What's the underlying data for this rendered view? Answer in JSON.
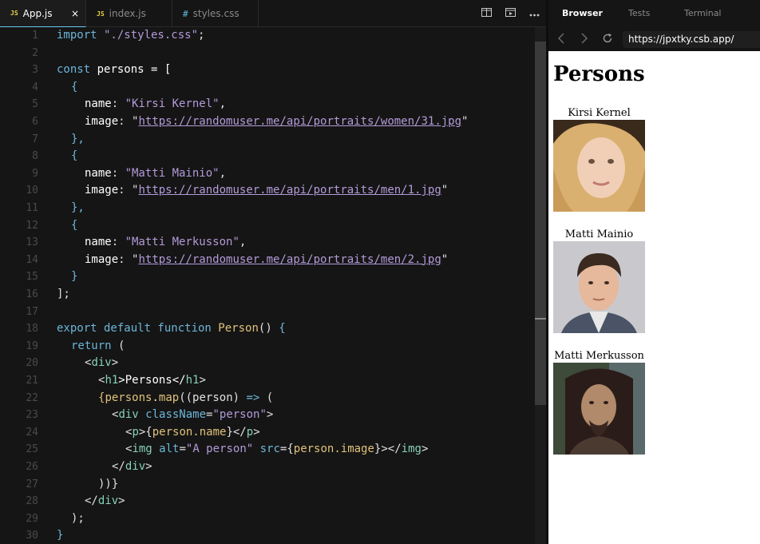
{
  "editor": {
    "tabs": [
      {
        "label": "App.js",
        "badge": "JS",
        "active": true,
        "close": "×"
      },
      {
        "label": "index.js",
        "badge": "JS",
        "active": false
      },
      {
        "label": "styles.css",
        "badge": "#",
        "active": false
      }
    ],
    "line_numbers": [
      "1",
      "2",
      "3",
      "4",
      "5",
      "6",
      "7",
      "8",
      "9",
      "10",
      "11",
      "12",
      "13",
      "14",
      "15",
      "16",
      "17",
      "18",
      "19",
      "20",
      "21",
      "22",
      "23",
      "24",
      "25",
      "26",
      "27",
      "28",
      "29",
      "30"
    ],
    "code": {
      "l1_kw": "import",
      "l1_str": " \"./styles.css\"",
      "l1_end": ";",
      "l3_kw": "const",
      "l3_rest": " persons = [",
      "l4": "{",
      "l5_key": "name",
      "l5_p": ": ",
      "l5_str": "\"Kirsi Kernel\"",
      "l5_end": ",",
      "l6_key": "image",
      "l6_p": ": \"",
      "l6_url": "https://randomuser.me/api/portraits/women/31.jpg",
      "l6_end": "\"",
      "l7": "},",
      "l8": "{",
      "l9_key": "name",
      "l9_p": ": ",
      "l9_str": "\"Matti Mainio\"",
      "l9_end": ",",
      "l10_key": "image",
      "l10_p": ": \"",
      "l10_url": "https://randomuser.me/api/portraits/men/1.jpg",
      "l10_end": "\"",
      "l11": "},",
      "l12": "{",
      "l13_key": "name",
      "l13_p": ": ",
      "l13_str": "\"Matti Merkusson\"",
      "l13_end": ",",
      "l14_key": "image",
      "l14_p": ": \"",
      "l14_url": "https://randomuser.me/api/portraits/men/2.jpg",
      "l14_end": "\"",
      "l15": "}",
      "l16": "];",
      "l18_kw": "export default function",
      "l18_fn": " Person",
      "l18_rest": "() ",
      "l18_brace": "{",
      "l19_kw": "return",
      "l19_rest": " (",
      "l20_a": "<",
      "l20_tag": "div",
      "l20_b": ">",
      "l21_a": "<",
      "l21_tag": "h1",
      "l21_b": ">Persons</",
      "l21_tag2": "h1",
      "l21_c": ">",
      "l22_a": "{",
      "l22_fn": "persons",
      "l22_b": ".",
      "l22_fn2": "map",
      "l22_c": "((person) ",
      "l22_arrow": "=>",
      "l22_d": " (",
      "l23_a": "<",
      "l23_tag": "div",
      "l23_attr": " className",
      "l23_b": "=",
      "l23_str": "\"person\"",
      "l23_c": ">",
      "l24_a": "<",
      "l24_tag": "p",
      "l24_b": ">{",
      "l24_fn": "person.name",
      "l24_c": "}</",
      "l24_tag2": "p",
      "l24_d": ">",
      "l25_a": "<",
      "l25_tag": "img",
      "l25_attr": " alt",
      "l25_b": "=",
      "l25_str": "\"A person\"",
      "l25_attr2": " src",
      "l25_c": "={",
      "l25_fn": "person.image",
      "l25_d": "}></",
      "l25_tag2": "img",
      "l25_e": ">",
      "l26_a": "</",
      "l26_tag": "div",
      "l26_b": ">",
      "l27": "))}",
      "l28_a": "</",
      "l28_tag": "div",
      "l28_b": ">",
      "l29": ");",
      "l30": "}"
    }
  },
  "preview": {
    "tabs": [
      "Browser",
      "Tests",
      "Terminal"
    ],
    "url": "https://jpxtky.csb.app/",
    "heading": "Persons",
    "persons": [
      {
        "name": "Kirsi Kernel"
      },
      {
        "name": "Matti Mainio"
      },
      {
        "name": "Matti Merkusson"
      }
    ]
  }
}
